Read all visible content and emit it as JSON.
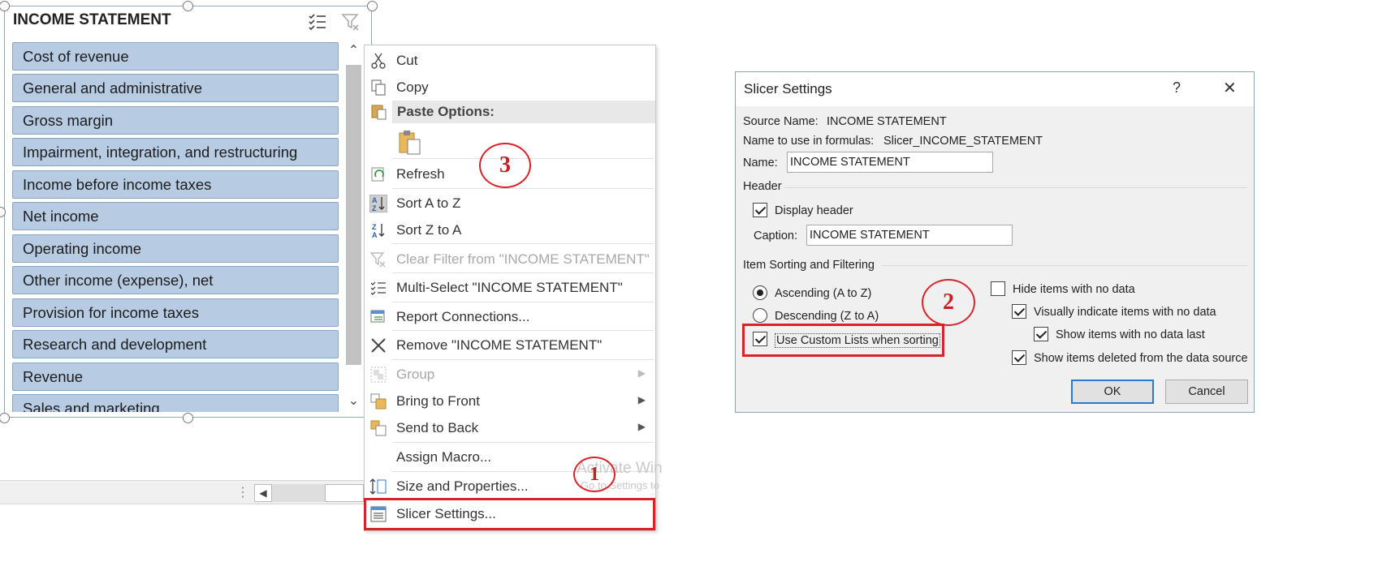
{
  "slicer": {
    "header": "INCOME STATEMENT",
    "items": [
      "Cost of revenue",
      "General and administrative",
      "Gross margin",
      "Impairment, integration, and restructuring",
      "Income before income taxes",
      "Net income",
      "Operating income",
      "Other income (expense), net",
      "Provision for income taxes",
      "Research and development",
      "Revenue",
      "Sales and marketing"
    ],
    "icons": [
      "multi-select-icon",
      "clear-filter-icon"
    ]
  },
  "context_menu": {
    "cut": "Cut",
    "copy": "Copy",
    "paste_options": "Paste Options:",
    "refresh": "Refresh",
    "sort_az": "Sort A to Z",
    "sort_za": "Sort Z to A",
    "clear_filter": "Clear Filter from \"INCOME STATEMENT\"",
    "multi_select": "Multi-Select \"INCOME STATEMENT\"",
    "report_connections": "Report Connections...",
    "remove": "Remove \"INCOME STATEMENT\"",
    "group": "Group",
    "bring_to_front": "Bring to Front",
    "send_to_back": "Send to Back",
    "assign_macro": "Assign Macro...",
    "size_properties": "Size and Properties...",
    "slicer_settings": "Slicer Settings..."
  },
  "annotations": {
    "one": "1",
    "two": "2",
    "three": "3",
    "color": "#d9232a"
  },
  "watermark": {
    "line1": "Activate Win",
    "line2": "Go to Settings to"
  },
  "dialog": {
    "title": "Slicer Settings",
    "help": "?",
    "close": "✕",
    "source_name_label": "Source Name:",
    "source_name_value": "INCOME STATEMENT",
    "formula_label": "Name to use in formulas:",
    "formula_value": "Slicer_INCOME_STATEMENT",
    "name_label": "Name:",
    "name_value": "INCOME STATEMENT",
    "header_section": "Header",
    "display_header": "Display header",
    "caption_label": "Caption:",
    "caption_value": "INCOME STATEMENT",
    "sorting_section": "Item Sorting and Filtering",
    "ascending": "Ascending (A to Z)",
    "descending": "Descending (Z to A)",
    "use_custom_lists": "Use Custom Lists when sorting",
    "hide_items": "Hide items with no data",
    "visually_indicate": "Visually indicate items with no data",
    "show_items_last": "Show items with no data last",
    "show_deleted": "Show items deleted from the data source",
    "ok": "OK",
    "cancel": "Cancel"
  },
  "colors": {
    "slicer_item_bg": "#b7cbe3",
    "accent_red": "#d9232a",
    "ok_border": "#2a7ad3"
  }
}
